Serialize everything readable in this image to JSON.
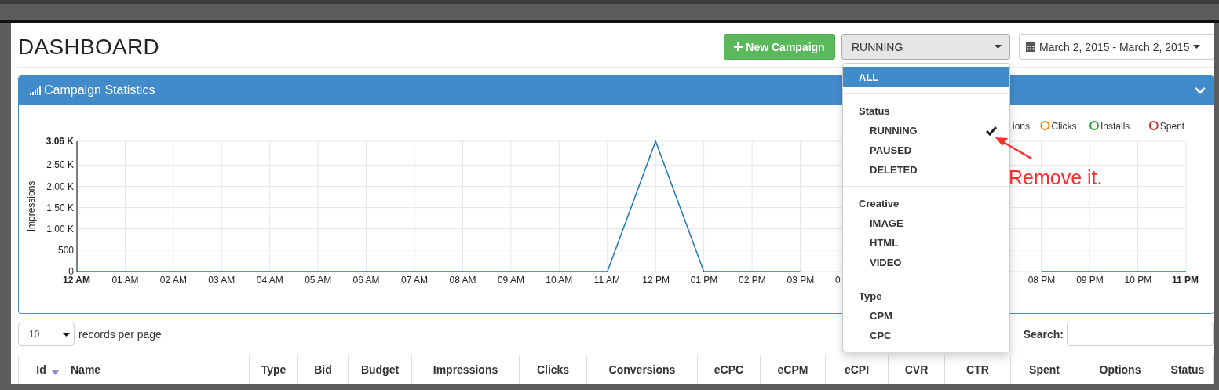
{
  "header": {
    "title": "DASHBOARD",
    "new_campaign_button": "New Campaign",
    "status_select": "RUNNING",
    "date_range": "March 2, 2015 - March 2, 2015"
  },
  "status_menu": {
    "top_option": {
      "label": "ALL",
      "highlighted": true,
      "checked": false
    },
    "groups": [
      {
        "title": "Status",
        "options": [
          {
            "label": "RUNNING",
            "checked": true,
            "highlighted": false
          },
          {
            "label": "PAUSED",
            "checked": false,
            "highlighted": false
          },
          {
            "label": "DELETED",
            "checked": false,
            "highlighted": false
          }
        ]
      },
      {
        "title": "Creative",
        "options": [
          {
            "label": "IMAGE",
            "checked": false,
            "highlighted": false
          },
          {
            "label": "HTML",
            "checked": false,
            "highlighted": false
          },
          {
            "label": "VIDEO",
            "checked": false,
            "highlighted": false
          }
        ]
      },
      {
        "title": "Type",
        "options": [
          {
            "label": "CPM",
            "checked": false,
            "highlighted": false
          },
          {
            "label": "CPC",
            "checked": false,
            "highlighted": false
          }
        ]
      }
    ]
  },
  "annotation": {
    "text": "Remove it."
  },
  "panel": {
    "title": "Campaign Statistics",
    "expanded": true,
    "legend": [
      {
        "label": "ions"
      },
      {
        "label": "Clicks",
        "color": "#ff7f0e"
      },
      {
        "label": "Installs",
        "color": "#2ca02c"
      },
      {
        "label": "Spent",
        "color": "#d62728"
      }
    ],
    "chart_data": {
      "type": "line",
      "ylabel": "Impressions",
      "grid": true,
      "categories": [
        "12 AM",
        "01 AM",
        "02 AM",
        "03 AM",
        "04 AM",
        "05 AM",
        "06 AM",
        "07 AM",
        "08 AM",
        "09 AM",
        "10 AM",
        "11 AM",
        "12 PM",
        "01 PM",
        "02 PM",
        "03 PM",
        "0",
        null,
        null,
        null,
        "08 PM",
        "09 PM",
        "10 PM",
        "11 PM"
      ],
      "series": [
        {
          "color": "#1f77b4",
          "values": [
            0,
            0,
            0,
            0,
            0,
            0,
            0,
            0,
            0,
            0,
            0,
            0,
            3060,
            0,
            0,
            0,
            null,
            null,
            null,
            null,
            0,
            0,
            0,
            0
          ]
        }
      ],
      "ylim": [
        0,
        3060
      ],
      "yticks": [
        0,
        500,
        {
          "value": 1000,
          "label": "1.00 K"
        },
        {
          "value": 1500,
          "label": "1.50 K"
        },
        {
          "value": 2000,
          "label": "2.00 K"
        },
        {
          "value": 2500,
          "label": "2.50 K"
        },
        {
          "value": 3060,
          "label": "3.06 K"
        }
      ]
    }
  },
  "records": {
    "page_size": "10",
    "label": "records per page",
    "search_label": "Search:"
  },
  "table": {
    "columns": [
      {
        "label": "Id",
        "sorted": true
      },
      {
        "label": "Name",
        "sorted": false
      },
      {
        "label": "Type",
        "sorted": false
      },
      {
        "label": "Bid",
        "sorted": false
      },
      {
        "label": "Budget",
        "sorted": false
      },
      {
        "label": "Impressions",
        "sorted": false
      },
      {
        "label": "Clicks",
        "sorted": false
      },
      {
        "label": "Conversions",
        "sorted": false
      },
      {
        "label": "eCPC",
        "sorted": false
      },
      {
        "label": "eCPM",
        "sorted": false
      },
      {
        "label": "eCPI",
        "sorted": false
      },
      {
        "label": "CVR",
        "sorted": false
      },
      {
        "label": "CTR",
        "sorted": false
      },
      {
        "label": "Spent",
        "sorted": false
      },
      {
        "label": "Options",
        "sorted": false
      },
      {
        "label": "Status",
        "sorted": false
      }
    ]
  }
}
